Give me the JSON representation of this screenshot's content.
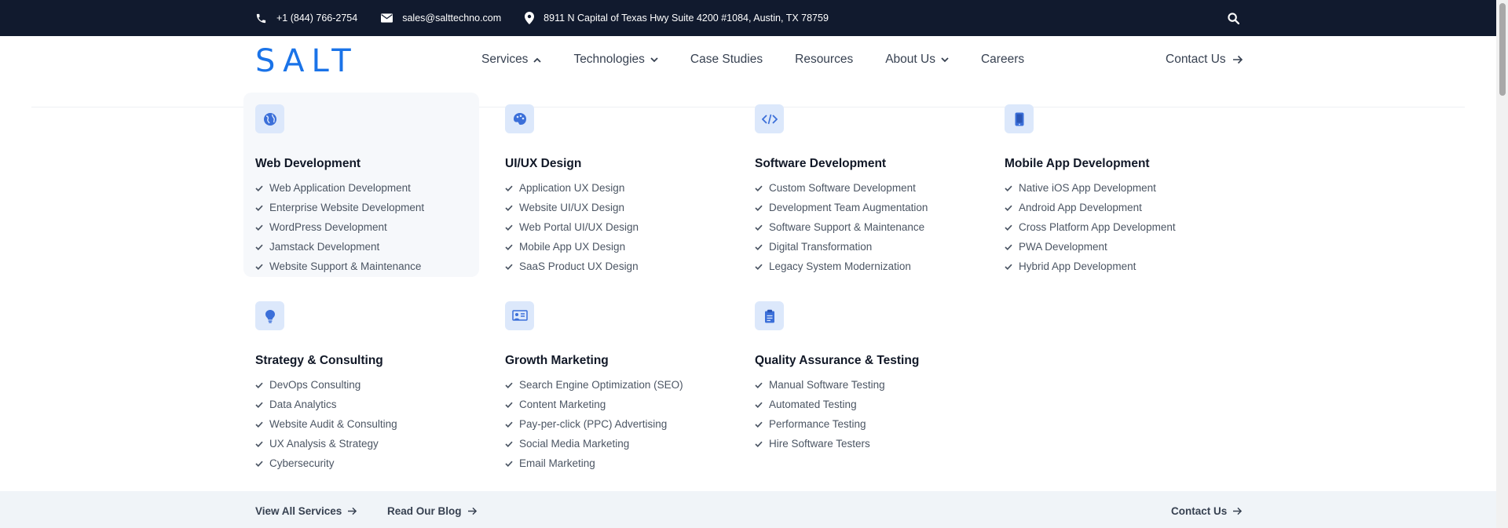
{
  "topbar": {
    "phone": "+1 (844) 766-2754",
    "email": "sales@salttechno.com",
    "address": "8911 N Capital of Texas Hwy Suite 4200 #1084, Austin, TX 78759"
  },
  "brand": {
    "logo": "SALT",
    "accent": "#1a73e8",
    "dark": "#111a2e"
  },
  "nav": {
    "items": [
      {
        "label": "Services",
        "dropdown": "open"
      },
      {
        "label": "Technologies",
        "dropdown": "closed"
      },
      {
        "label": "Case Studies"
      },
      {
        "label": "Resources"
      },
      {
        "label": "About Us",
        "dropdown": "closed"
      },
      {
        "label": "Careers"
      }
    ],
    "contact": "Contact Us"
  },
  "categories": [
    {
      "title": "Web Development",
      "icon": "globe-icon",
      "items": [
        "Web Application Development",
        "Enterprise Website Development",
        "WordPress Development",
        "Jamstack Development",
        "Website Support & Maintenance"
      ]
    },
    {
      "title": "UI/UX Design",
      "icon": "palette-icon",
      "items": [
        "Application UX Design",
        "Website UI/UX Design",
        "Web Portal UI/UX Design",
        "Mobile App UX Design",
        "SaaS Product UX Design"
      ]
    },
    {
      "title": "Software Development",
      "icon": "code-icon",
      "items": [
        "Custom Software Development",
        "Development Team Augmentation",
        "Software Support & Maintenance",
        "Digital Transformation",
        "Legacy System Modernization"
      ]
    },
    {
      "title": "Mobile App Development",
      "icon": "mobile-icon",
      "items": [
        "Native iOS App Development",
        "Android App Development",
        "Cross Platform App Development",
        "PWA Development",
        "Hybrid App Development"
      ]
    },
    {
      "title": "Strategy & Consulting",
      "icon": "lightbulb-icon",
      "items": [
        "DevOps Consulting",
        "Data Analytics",
        "Website Audit & Consulting",
        "UX Analysis & Strategy",
        "Cybersecurity"
      ]
    },
    {
      "title": "Growth Marketing",
      "icon": "presentation-icon",
      "items": [
        "Search Engine Optimization (SEO)",
        "Content Marketing",
        "Pay-per-click (PPC) Advertising",
        "Social Media Marketing",
        "Email Marketing"
      ]
    },
    {
      "title": "Quality Assurance & Testing",
      "icon": "clipboard-icon",
      "items": [
        "Manual Software Testing",
        "Automated Testing",
        "Performance Testing",
        "Hire Software Testers"
      ]
    }
  ],
  "footer": {
    "view_all": "View All Services",
    "blog": "Read Our Blog",
    "contact": "Contact Us"
  }
}
